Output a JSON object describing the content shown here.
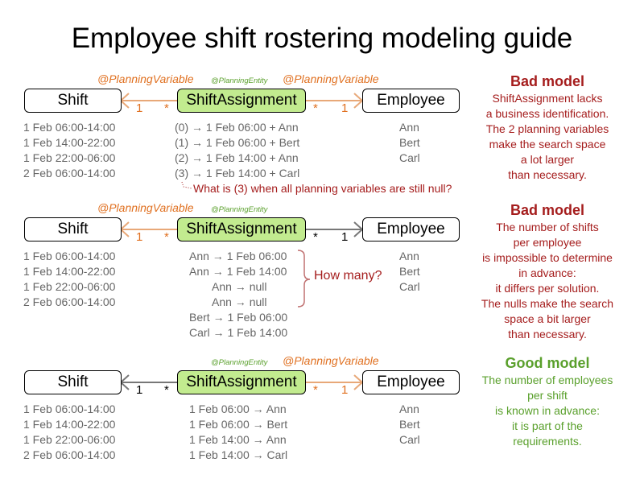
{
  "title": "Employee shift rostering modeling guide",
  "colors": {
    "variable": "#e07020",
    "entity": "#5aa02c",
    "entity_fill": "#c2eb8f",
    "bad": "#a51d1d",
    "good": "#5aa02c",
    "data_text": "#666666"
  },
  "models": [
    {
      "annotations": {
        "shift_side": "@PlanningVariable",
        "entity": "@PlanningEntity",
        "employee_side": "@PlanningVariable"
      },
      "boxes": {
        "left": "Shift",
        "center": "ShiftAssignment",
        "right": "Employee"
      },
      "multiplicities": {
        "left_one": "1",
        "left_many": "*",
        "right_many": "*",
        "right_one": "1"
      },
      "shifts": [
        "1 Feb 06:00-14:00",
        "1 Feb 14:00-22:00",
        "1 Feb 22:00-06:00",
        "2 Feb 06:00-14:00"
      ],
      "assignments": [
        "(0) → 1 Feb 06:00 + Ann",
        "(1) → 1 Feb 06:00 + Bert",
        "(2) → 1 Feb 14:00 + Ann",
        "(3) → 1 Feb 14:00 + Carl"
      ],
      "employees": [
        "Ann",
        "Bert",
        "Carl"
      ],
      "note": "What is (3) when all planning variables are still null?",
      "verdict": {
        "head": "Bad model",
        "lines": [
          "ShiftAssignment lacks",
          "a business identification.",
          "The 2 planning variables",
          "make the search space",
          "a lot larger",
          "than necessary."
        ]
      }
    },
    {
      "annotations": {
        "shift_side": "@PlanningVariable",
        "entity": "@PlanningEntity"
      },
      "boxes": {
        "left": "Shift",
        "center": "ShiftAssignment",
        "right": "Employee"
      },
      "multiplicities": {
        "left_one": "1",
        "left_many": "*",
        "right_many": "*",
        "right_one": "1"
      },
      "shifts": [
        "1 Feb 06:00-14:00",
        "1 Feb 14:00-22:00",
        "1 Feb 22:00-06:00",
        "2 Feb 06:00-14:00"
      ],
      "assignments": [
        "Ann → 1 Feb 06:00",
        "Ann → 1 Feb 14:00",
        "Ann → null",
        "Ann → null",
        "Bert → 1 Feb 06:00",
        "Carl → 1 Feb 14:00"
      ],
      "employees": [
        "Ann",
        "Bert",
        "Carl"
      ],
      "note": "How many?",
      "verdict": {
        "head": "Bad model",
        "lines": [
          "The number of shifts",
          "per employee",
          "is impossible to determine",
          "in advance:",
          "it differs per solution.",
          "The nulls make the search",
          "space a bit larger",
          "than necessary."
        ]
      }
    },
    {
      "annotations": {
        "entity": "@PlanningEntity",
        "employee_side": "@PlanningVariable"
      },
      "boxes": {
        "left": "Shift",
        "center": "ShiftAssignment",
        "right": "Employee"
      },
      "multiplicities": {
        "left_one": "1",
        "left_many": "*",
        "right_many": "*",
        "right_one": "1"
      },
      "shifts": [
        "1 Feb 06:00-14:00",
        "1 Feb 14:00-22:00",
        "1 Feb 22:00-06:00",
        "2 Feb 06:00-14:00"
      ],
      "assignments": [
        "1 Feb 06:00 → Ann",
        "1 Feb 06:00 → Bert",
        "1 Feb 14:00 → Ann",
        "1 Feb 14:00 → Carl"
      ],
      "employees": [
        "Ann",
        "Bert",
        "Carl"
      ],
      "verdict": {
        "head": "Good model",
        "lines": [
          "The number of employees",
          "per shift",
          "is known in advance:",
          "it is part of the",
          "requirements."
        ]
      }
    }
  ]
}
